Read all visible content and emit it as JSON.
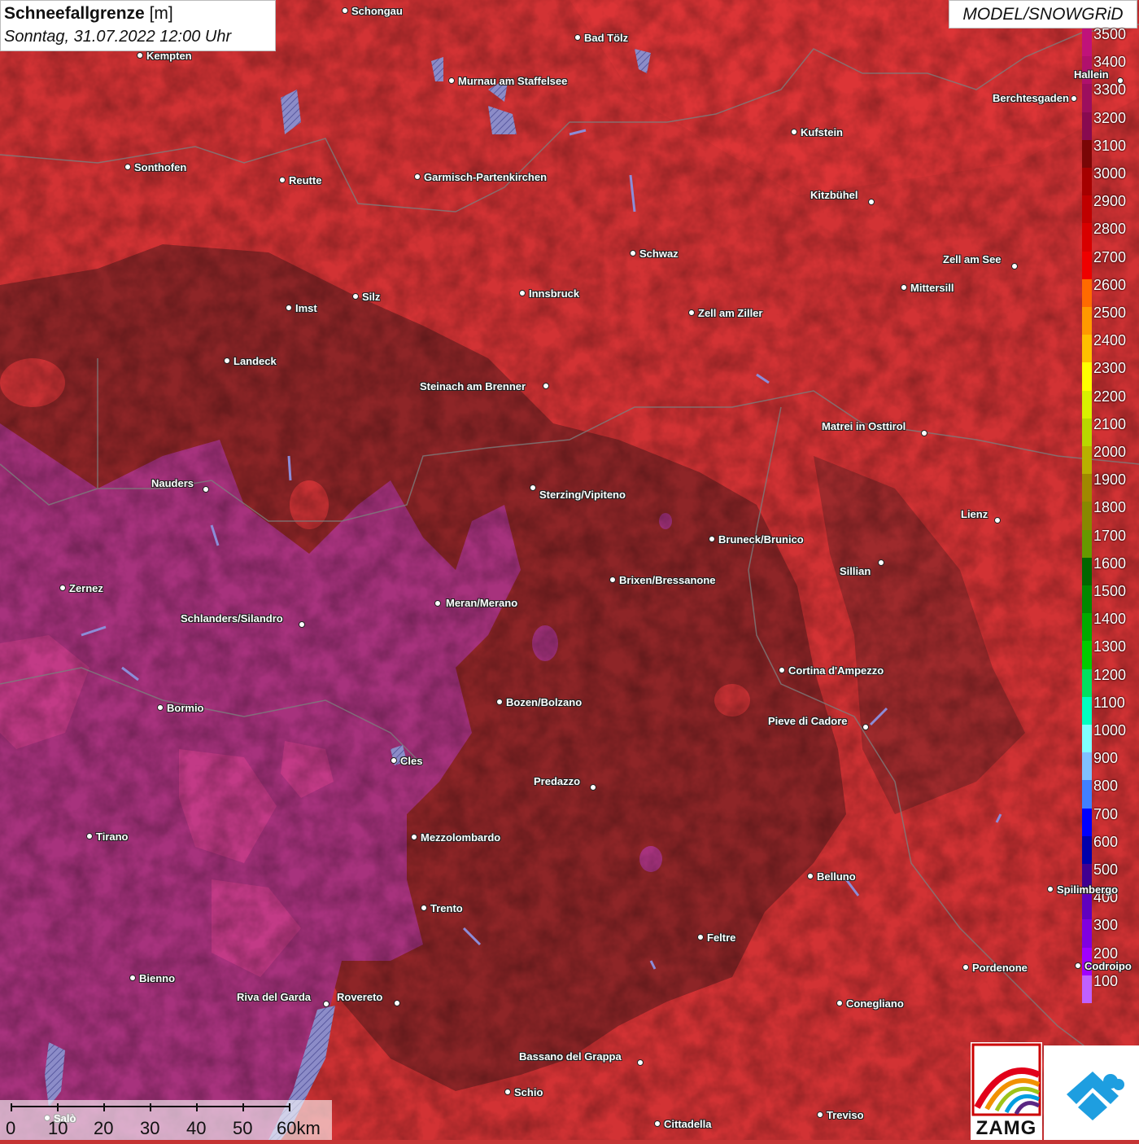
{
  "header": {
    "title_bold": "Schneefallgrenze",
    "title_unit": "[m]",
    "subtitle": "Sonntag, 31.07.2022 12:00 Uhr"
  },
  "model_label": "MODEL/SNOWGRiD",
  "legend": {
    "labels": [
      "3500",
      "3400",
      "3300",
      "3200",
      "3100",
      "3000",
      "2900",
      "2800",
      "2700",
      "2600",
      "2500",
      "2400",
      "2300",
      "2200",
      "2100",
      "2000",
      "1900",
      "1800",
      "1700",
      "1600",
      "1500",
      "1400",
      "1300",
      "1200",
      "1100",
      "1000",
      "900",
      "800",
      "700",
      "600",
      "500",
      "400",
      "300",
      "200",
      "100"
    ],
    "colors": [
      "#c0127a",
      "#b0106c",
      "#9c0e5e",
      "#880a50",
      "#7a0606",
      "#a60000",
      "#c00000",
      "#d80000",
      "#ee0000",
      "#ff6a00",
      "#ff9900",
      "#ffc000",
      "#ffff00",
      "#d8f000",
      "#b8d800",
      "#b8b000",
      "#a08800",
      "#888800",
      "#669900",
      "#006600",
      "#008800",
      "#00aa00",
      "#00cc00",
      "#00e060",
      "#00ffc0",
      "#80ffff",
      "#80c0ff",
      "#4080ff",
      "#0000ff",
      "#0000aa",
      "#400090",
      "#6000c0",
      "#8000e0",
      "#a000ff",
      "#c060ff"
    ]
  },
  "cities": [
    {
      "name": "Schongau"
    },
    {
      "name": "Bad Tölz"
    },
    {
      "name": "Kempten"
    },
    {
      "name": "Murnau am Staffelsee"
    },
    {
      "name": "Hallein"
    },
    {
      "name": "Berchtesgaden"
    },
    {
      "name": "Kufstein"
    },
    {
      "name": "Sonthofen"
    },
    {
      "name": "Reutte"
    },
    {
      "name": "Garmisch-Partenkirchen"
    },
    {
      "name": "Kitzbühel"
    },
    {
      "name": "Schwaz"
    },
    {
      "name": "Zell am See"
    },
    {
      "name": "Innsbruck"
    },
    {
      "name": "Mittersill"
    },
    {
      "name": "Silz"
    },
    {
      "name": "Imst"
    },
    {
      "name": "Zell am Ziller"
    },
    {
      "name": "Landeck"
    },
    {
      "name": "Steinach am Brenner"
    },
    {
      "name": "Matrei in Osttirol"
    },
    {
      "name": "Nauders"
    },
    {
      "name": "Sterzing/Vipiteno"
    },
    {
      "name": "Lienz"
    },
    {
      "name": "Bruneck/Brunico"
    },
    {
      "name": "Sillian"
    },
    {
      "name": "Zernez"
    },
    {
      "name": "Brixen/Bressanone"
    },
    {
      "name": "Meran/Merano"
    },
    {
      "name": "Schlanders/Silandro"
    },
    {
      "name": "Cortina d'Ampezzo"
    },
    {
      "name": "Bozen/Bolzano"
    },
    {
      "name": "Bormio"
    },
    {
      "name": "Pieve di Cadore"
    },
    {
      "name": "Cles"
    },
    {
      "name": "Predazzo"
    },
    {
      "name": "Tirano"
    },
    {
      "name": "Mezzolombardo"
    },
    {
      "name": "Belluno"
    },
    {
      "name": "Spilimbergo"
    },
    {
      "name": "Trento"
    },
    {
      "name": "Feltre"
    },
    {
      "name": "Pordenone"
    },
    {
      "name": "Codroipo"
    },
    {
      "name": "Bienno"
    },
    {
      "name": "Riva del Garda"
    },
    {
      "name": "Rovereto"
    },
    {
      "name": "Conegliano"
    },
    {
      "name": "Bassano del Grappa"
    },
    {
      "name": "Schio"
    },
    {
      "name": "Treviso"
    },
    {
      "name": "Cittadella"
    },
    {
      "name": "Salò"
    }
  ],
  "scale_bar": {
    "labels": [
      "0",
      "10",
      "20",
      "30",
      "40",
      "50",
      "60km"
    ]
  },
  "logos": {
    "zamg_text": "ZAMG"
  }
}
